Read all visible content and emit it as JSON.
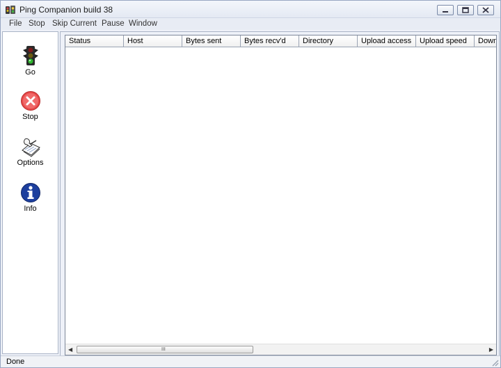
{
  "window": {
    "title": "Ping Companion build 38"
  },
  "menu": {
    "items": [
      "File",
      "Stop",
      "Skip Current",
      "Pause",
      "Window"
    ]
  },
  "toolbar": {
    "go_label": "Go",
    "stop_label": "Stop",
    "options_label": "Options",
    "info_label": "Info"
  },
  "list": {
    "columns": [
      "Status",
      "Host",
      "Bytes sent",
      "Bytes recv'd",
      "Directory",
      "Upload access",
      "Upload speed",
      "Down"
    ],
    "rows": [],
    "scroll_grip": "III"
  },
  "statusbar": {
    "text": "Done"
  },
  "colors": {
    "title_bg": "#e4e9f3",
    "stop_red": "#e84a4a",
    "info_blue": "#1d3f9e",
    "light_green": "#2fb82f"
  },
  "icons": {
    "go": "traffic-light-icon",
    "stop": "stop-x-icon",
    "options": "options-hand-icon",
    "info": "info-icon"
  }
}
